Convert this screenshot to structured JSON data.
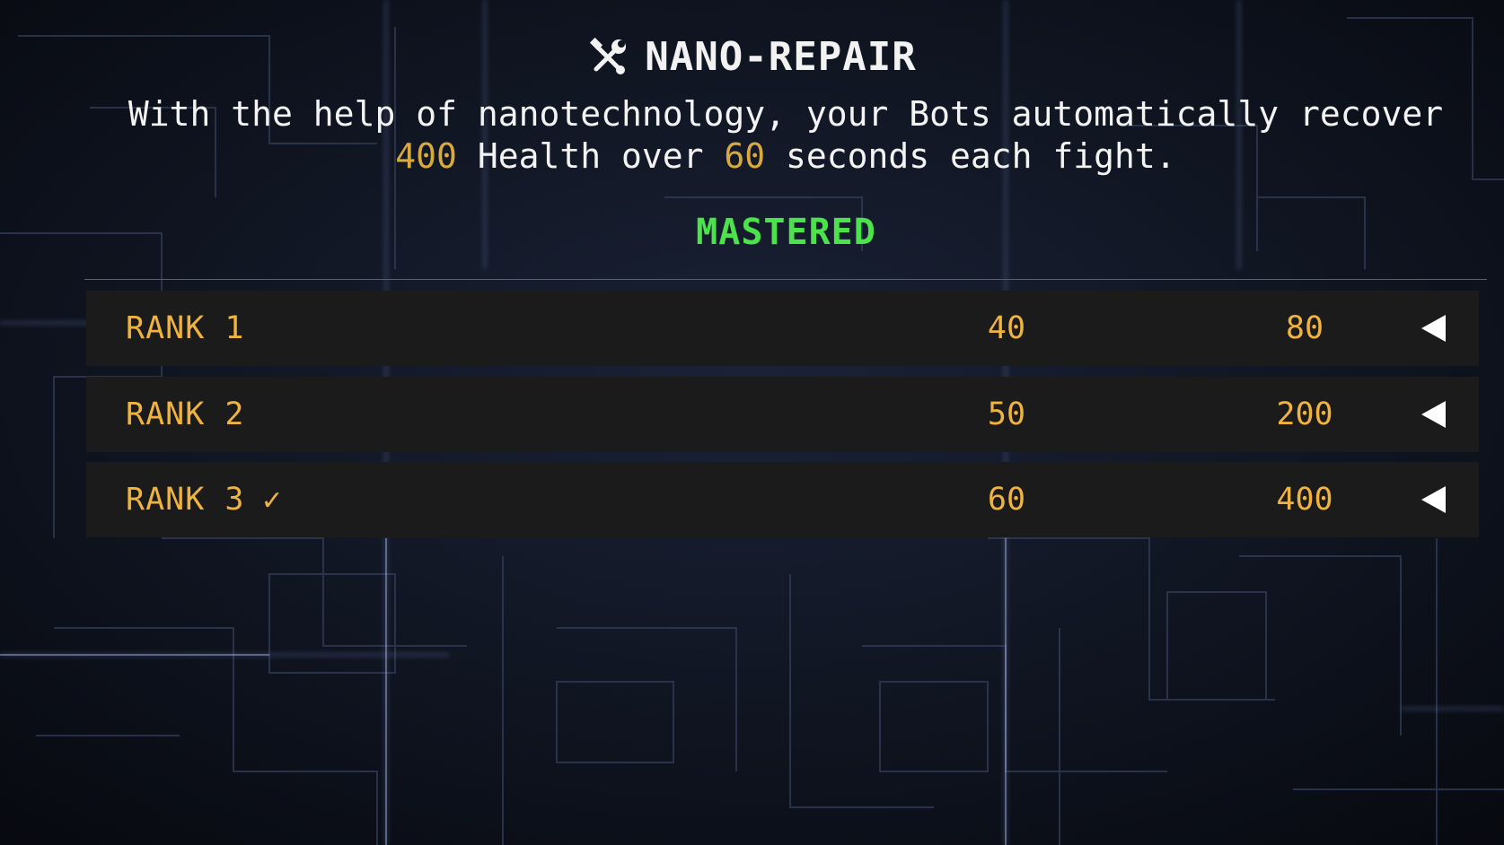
{
  "skill": {
    "title": "NANO-REPAIR",
    "icon": "wrench-screwdriver-icon",
    "description": {
      "part1": "With the help of nanotechnology, your Bots automatically recover ",
      "health_value": "400",
      "part2": " Health over ",
      "seconds_value": "60",
      "part3": " seconds each fight."
    },
    "status": "MASTERED"
  },
  "ranks": [
    {
      "label": "RANK 1",
      "value_a": "40",
      "value_b": "80",
      "checked": false
    },
    {
      "label": "RANK 2",
      "value_a": "50",
      "value_b": "200",
      "checked": false
    },
    {
      "label": "RANK 3",
      "value_a": "60",
      "value_b": "400",
      "checked": true,
      "check_mark": "✓"
    }
  ],
  "colors": {
    "background": "#0d111c",
    "title": "#f2f2f2",
    "highlight": "#d9a93c",
    "mastered": "#4be24b",
    "rank_text": "#f0b33d",
    "row_bg": "#1b1b1c"
  }
}
